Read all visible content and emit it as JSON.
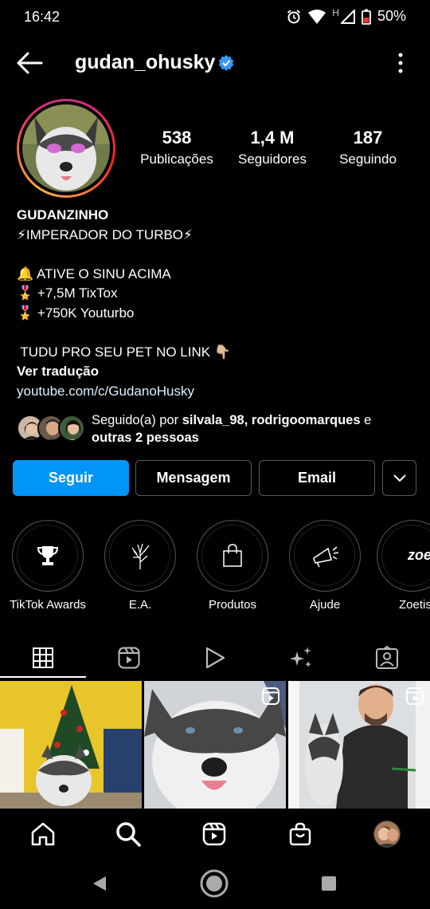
{
  "status_bar": {
    "time": "16:42",
    "network_letter": "H",
    "battery": "50%",
    "icons": [
      "alarm-icon",
      "wifi-icon",
      "signal-icon",
      "battery-icon"
    ]
  },
  "header": {
    "username": "gudan_ohusky",
    "verified": true,
    "back_icon": "arrow-left-icon",
    "more_icon": "more-vertical-icon"
  },
  "profile": {
    "stats": [
      {
        "value": "538",
        "label": "Publicações"
      },
      {
        "value": "1,4 M",
        "label": "Seguidores"
      },
      {
        "value": "187",
        "label": "Seguindo"
      }
    ]
  },
  "bio": {
    "name": "GUDANZINHO",
    "lines": [
      "⚡IMPERADOR DO TURBO⚡",
      "",
      "🔔 ATIVE O SINU ACIMA",
      "🎖️ +7,5M TixTox",
      "🎖️ +750K Youturbo",
      "",
      " TUDU PRO SEU PET NO LINK 👇🏼"
    ],
    "translate": "Ver tradução",
    "link": "youtube.com/c/GudanoHusky"
  },
  "followed_by": {
    "prefix": "Seguido(a) por ",
    "user1": "silvala_98",
    "separator": ", ",
    "user2": "rodrigoomarques",
    "suffix": " e",
    "others": "outras 2 pessoas"
  },
  "actions": {
    "follow": "Seguir",
    "message": "Mensagem",
    "email": "Email",
    "dropdown_icon": "chevron-down-icon"
  },
  "highlights": [
    {
      "label": "TikTok Awards",
      "icon": "trophy-icon"
    },
    {
      "label": "E.A.",
      "icon": "tree-icon"
    },
    {
      "label": "Produtos",
      "icon": "shopping-bag-icon"
    },
    {
      "label": "Ajude",
      "icon": "megaphone-icon"
    },
    {
      "label": "Zoetis",
      "logo_text": "zoeti"
    }
  ],
  "tabs": [
    {
      "name": "grid",
      "icon": "grid-icon",
      "active": true
    },
    {
      "name": "reels",
      "icon": "reels-icon"
    },
    {
      "name": "videos",
      "icon": "play-icon"
    },
    {
      "name": "effects",
      "icon": "sparkles-icon"
    },
    {
      "name": "tagged",
      "icon": "tagged-person-icon"
    }
  ],
  "bottom_nav": [
    "home-icon",
    "search-icon",
    "reels-icon",
    "shop-icon",
    "profile-avatar"
  ],
  "colors": {
    "accent": "#0095f6",
    "verified": "#3897f0",
    "background": "#000000"
  }
}
